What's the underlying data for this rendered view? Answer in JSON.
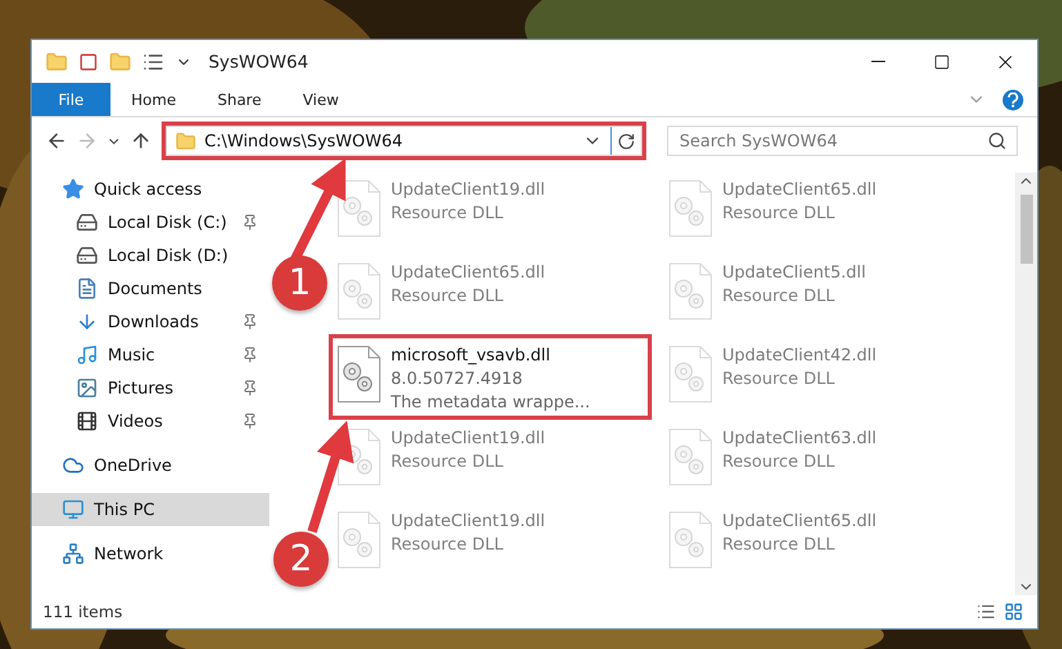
{
  "window": {
    "title": "SysWOW64"
  },
  "ribbon_tabs": [
    {
      "label": "File",
      "selected": true
    },
    {
      "label": "Home",
      "selected": false
    },
    {
      "label": "Share",
      "selected": false
    },
    {
      "label": "View",
      "selected": false
    }
  ],
  "address": {
    "path": "C:\\Windows\\SysWOW64",
    "highlighted": true
  },
  "search": {
    "placeholder": "Search SysWOW64"
  },
  "sidebar": {
    "items": [
      {
        "label": "Quick access",
        "selected": false,
        "children": [
          {
            "label": "Local Disk (C:)",
            "pinned": true,
            "selected": false
          },
          {
            "label": "Local Disk (D:)",
            "pinned": false,
            "selected": false
          },
          {
            "label": "Documents",
            "pinned": false,
            "selected": false
          },
          {
            "label": "Downloads",
            "pinned": true,
            "selected": false
          },
          {
            "label": "Music",
            "pinned": true,
            "selected": false
          },
          {
            "label": "Pictures",
            "pinned": true,
            "selected": false
          },
          {
            "label": "Videos",
            "pinned": true,
            "selected": false
          }
        ]
      },
      {
        "label": "OneDrive",
        "selected": false
      },
      {
        "label": "This PC",
        "selected": true
      },
      {
        "label": "Network",
        "selected": false
      }
    ]
  },
  "files": [
    {
      "name": "UpdateClient19.dll",
      "details": [
        "Resource DLL"
      ],
      "dimmed": true,
      "highlighted": false
    },
    {
      "name": "UpdateClient65.dll",
      "details": [
        "Resource DLL"
      ],
      "dimmed": true,
      "highlighted": false
    },
    {
      "name": "UpdateClient65.dll",
      "details": [
        "Resource DLL"
      ],
      "dimmed": true,
      "highlighted": false
    },
    {
      "name": "UpdateClient5.dll",
      "details": [
        "Resource DLL"
      ],
      "dimmed": true,
      "highlighted": false
    },
    {
      "name": "microsoft_vsavb.dll",
      "details": [
        "8.0.50727.4918",
        "The metadata wrappe..."
      ],
      "dimmed": false,
      "highlighted": true
    },
    {
      "name": "UpdateClient42.dll",
      "details": [
        "Resource DLL"
      ],
      "dimmed": true,
      "highlighted": false
    },
    {
      "name": "UpdateClient19.dll",
      "details": [
        "Resource DLL"
      ],
      "dimmed": true,
      "highlighted": false
    },
    {
      "name": "UpdateClient63.dll",
      "details": [
        "Resource DLL"
      ],
      "dimmed": true,
      "highlighted": false
    },
    {
      "name": "UpdateClient19.dll",
      "details": [
        "Resource DLL"
      ],
      "dimmed": true,
      "highlighted": false
    },
    {
      "name": "UpdateClient65.dll",
      "details": [
        "Resource DLL"
      ],
      "dimmed": true,
      "highlighted": false
    }
  ],
  "status_bar": {
    "count": "111 items"
  },
  "annotations": [
    {
      "number": "1"
    },
    {
      "number": "2"
    }
  ]
}
